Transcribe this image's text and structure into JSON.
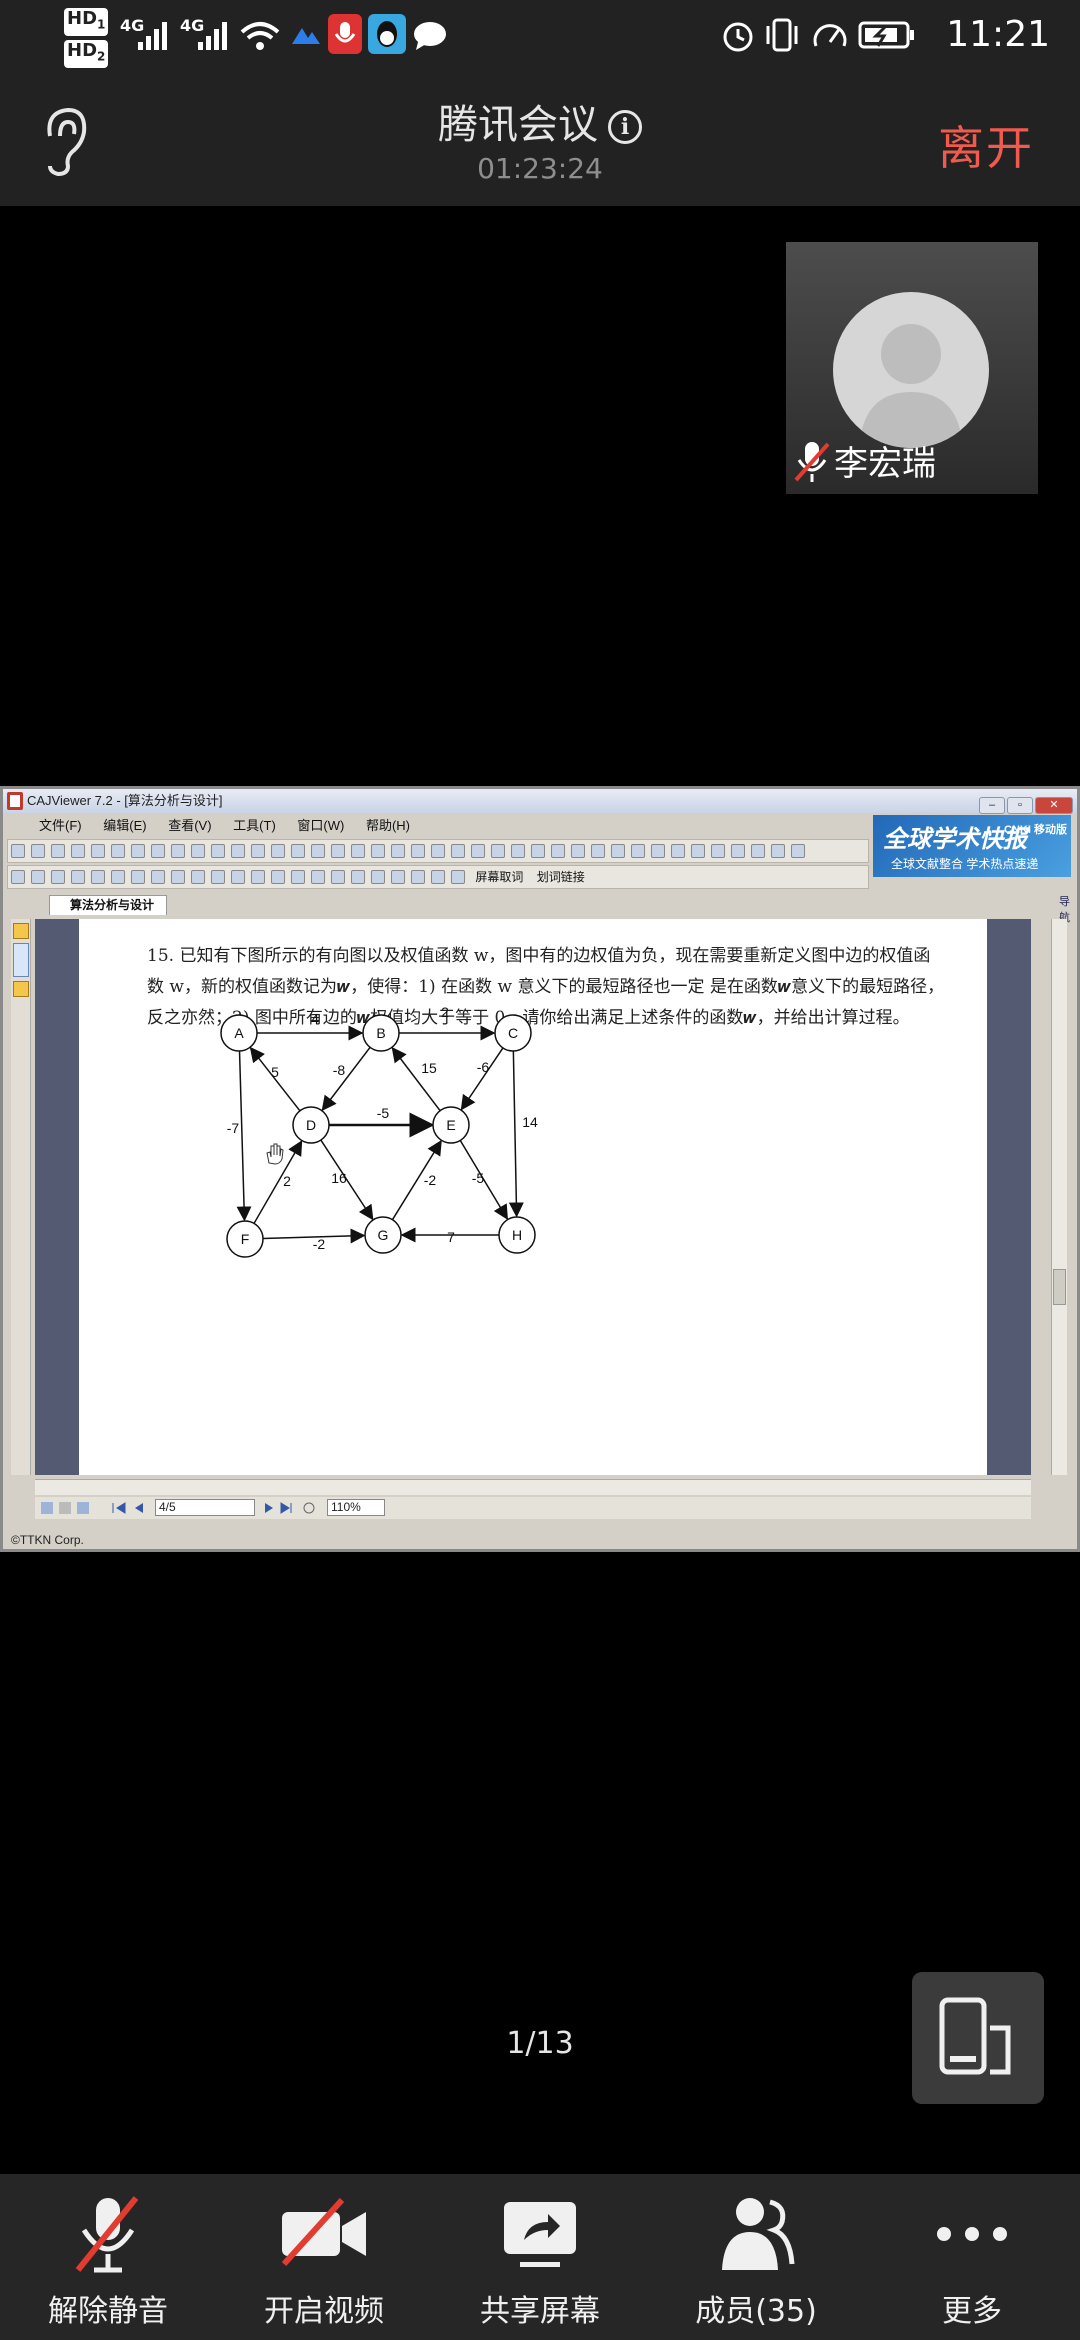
{
  "status_bar": {
    "time": "11:21",
    "network_1": "4G",
    "network_2": "4G",
    "hd_label_1": "HD",
    "hd_label_2": "HD",
    "icons": [
      "hd-icon",
      "signal-icon",
      "wifi-icon",
      "app-notification-icon",
      "mic-recording-icon",
      "qq-icon",
      "chat-icon",
      "alarm-icon",
      "vibrate-icon",
      "speed-icon",
      "battery-icon"
    ]
  },
  "meeting": {
    "title": "腾讯会议",
    "timer": "01:23:24",
    "leave_label": "离开",
    "info_glyph": "i"
  },
  "participant": {
    "name": "李宏瑞",
    "muted": true
  },
  "shared_screen": {
    "window_title": "CAJViewer 7.2 - [算法分析与设计]",
    "menu": [
      "文件(F)",
      "编辑(E)",
      "查看(V)",
      "工具(T)",
      "窗口(W)",
      "帮助(H)"
    ],
    "toolbar_text_1": "屏幕取词",
    "toolbar_text_2": "划词链接",
    "ad_title": "全球学术快报",
    "ad_subtitle": "全球文献整合 学术热点速递",
    "ad_tag": "CNKI 移动版",
    "tab_label": "算法分析与设计",
    "problem_lines": [
      "15. 已知有下图所示的有向图以及权值函数 w，图中有的边权值为负，现在需要重新定义图中边的权值函",
      "数 w，新的权值函数记为𝒘，使得：1) 在函数 w 意义下的最短路径也一定 是在函数𝒘意义下的最短路径，",
      "反之亦然；2) 图中所有边的𝒘权值均大于等于 0。请你给出满足上述条件的函数𝒘，并给出计算过程。"
    ],
    "graph": {
      "nodes": [
        "A",
        "B",
        "C",
        "D",
        "E",
        "F",
        "G",
        "H"
      ],
      "edges": [
        {
          "from": "A",
          "to": "B",
          "weight": "4"
        },
        {
          "from": "B",
          "to": "C",
          "weight": "2"
        },
        {
          "from": "D",
          "to": "A",
          "weight": "5"
        },
        {
          "from": "B",
          "to": "D",
          "weight": "-8"
        },
        {
          "from": "E",
          "to": "B",
          "weight": "15"
        },
        {
          "from": "C",
          "to": "E",
          "weight": "-6"
        },
        {
          "from": "D",
          "to": "E",
          "weight": "-5"
        },
        {
          "from": "A",
          "to": "F",
          "weight": "-7"
        },
        {
          "from": "C",
          "to": "H",
          "weight": "14"
        },
        {
          "from": "F",
          "to": "D",
          "weight": "2"
        },
        {
          "from": "D",
          "to": "G",
          "weight": "16"
        },
        {
          "from": "G",
          "to": "E",
          "weight": "-2"
        },
        {
          "from": "E",
          "to": "H",
          "weight": "-5"
        },
        {
          "from": "F",
          "to": "G",
          "weight": "-2"
        },
        {
          "from": "H",
          "to": "G",
          "weight": "7"
        }
      ]
    },
    "page_field": "4/5",
    "zoom_field": "110%",
    "copyright": "©TTKN Corp.",
    "side_pin": "导航"
  },
  "share_page_counter": "1/13",
  "bottom_toolbar": {
    "unmute_label": "解除静音",
    "video_label": "开启视频",
    "share_label": "共享屏幕",
    "members_label": "成员(35)",
    "more_label": "更多"
  }
}
